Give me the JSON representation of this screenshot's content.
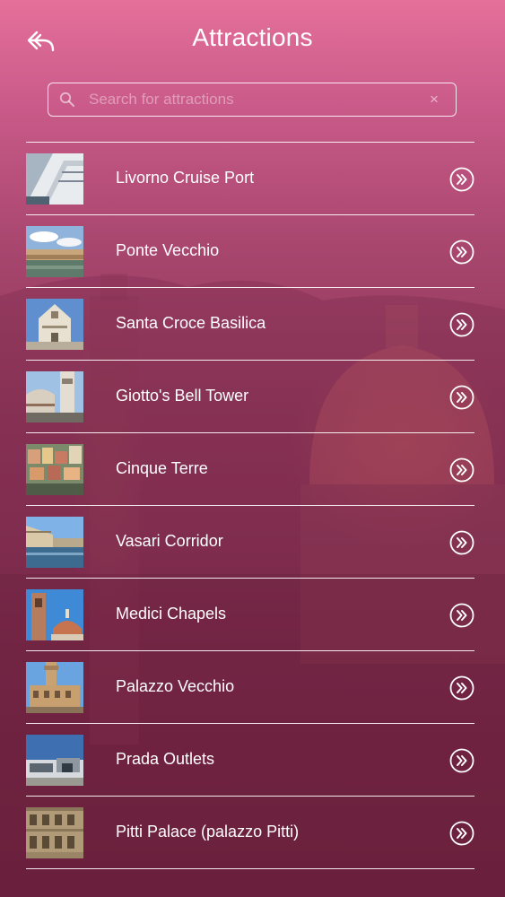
{
  "header": {
    "title": "Attractions",
    "back_icon": "back-arrow-icon"
  },
  "search": {
    "placeholder": "Search for attractions",
    "value": "",
    "search_icon": "search-icon",
    "clear_icon": "clear-icon",
    "clear_glyph": "×"
  },
  "attractions": [
    {
      "name": "Livorno Cruise Port",
      "thumbnail": "cruise-ship-photo"
    },
    {
      "name": "Ponte Vecchio",
      "thumbnail": "river-bridge-photo"
    },
    {
      "name": "Santa Croce Basilica",
      "thumbnail": "basilica-facade-photo"
    },
    {
      "name": "Giotto's Bell Tower",
      "thumbnail": "bell-tower-photo"
    },
    {
      "name": "Cinque Terre",
      "thumbnail": "coastal-village-photo"
    },
    {
      "name": "Vasari Corridor",
      "thumbnail": "corridor-river-photo"
    },
    {
      "name": "Medici Chapels",
      "thumbnail": "chapel-dome-photo"
    },
    {
      "name": "Palazzo Vecchio",
      "thumbnail": "palazzo-tower-photo"
    },
    {
      "name": "Prada Outlets",
      "thumbnail": "outlet-building-photo"
    },
    {
      "name": "Pitti Palace (palazzo Pitti)",
      "thumbnail": "palace-facade-photo"
    }
  ],
  "colors": {
    "background_top": "#e5709a",
    "background_bottom": "#661d39",
    "foreground": "#ffffff"
  }
}
